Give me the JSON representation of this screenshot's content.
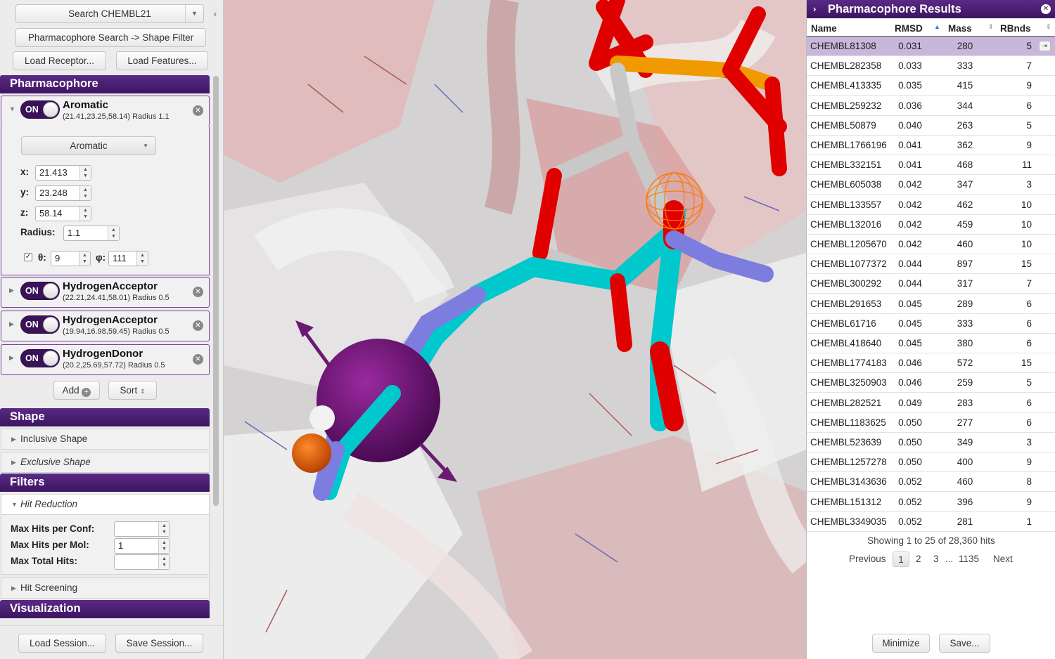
{
  "left": {
    "search_label": "Search CHEMBL21",
    "search_filter_label": "Pharmacophore Search -> Shape Filter",
    "load_receptor": "Load Receptor...",
    "load_features": "Load Features...",
    "pharmacophore_header": "Pharmacophore",
    "features": [
      {
        "toggle": "ON",
        "name": "Aromatic",
        "info": "(21.41,23.25,58.14) Radius 1.1"
      },
      {
        "toggle": "ON",
        "name": "HydrogenAcceptor",
        "info": "(22.21,24.41,58.01) Radius 0.5"
      },
      {
        "toggle": "ON",
        "name": "HydrogenAcceptor",
        "info": "(19.94,16.98,59.45) Radius 0.5"
      },
      {
        "toggle": "ON",
        "name": "HydrogenDonor",
        "info": "(20.2,25.69,57.72) Radius 0.5"
      }
    ],
    "editor": {
      "type": "Aromatic",
      "x_label": "x:",
      "x": "21.413",
      "y_label": "y:",
      "y": "23.248",
      "z_label": "z:",
      "z": "58.14",
      "radius_label": "Radius:",
      "radius": "1.1",
      "theta_label": "θ:",
      "theta": "9",
      "phi_label": "φ:",
      "phi": "111"
    },
    "add_label": "Add",
    "sort_label": "Sort",
    "shape_header": "Shape",
    "inclusive_shape": "Inclusive Shape",
    "exclusive_shape": "Exclusive Shape",
    "filters_header": "Filters",
    "hit_reduction": "Hit Reduction",
    "max_hits_conf_label": "Max Hits per Conf:",
    "max_hits_conf": "",
    "max_hits_mol_label": "Max Hits per Mol:",
    "max_hits_mol": "1",
    "max_total_label": "Max Total Hits:",
    "max_total": "",
    "hit_screening": "Hit Screening",
    "visualization_header": "Visualization",
    "load_session": "Load Session...",
    "save_session": "Save Session..."
  },
  "results": {
    "title": "Pharmacophore Results",
    "columns": [
      "Name",
      "RMSD",
      "Mass",
      "RBnds"
    ],
    "rows": [
      [
        "CHEMBL81308",
        "0.031",
        "280",
        "5"
      ],
      [
        "CHEMBL282358",
        "0.033",
        "333",
        "7"
      ],
      [
        "CHEMBL413335",
        "0.035",
        "415",
        "9"
      ],
      [
        "CHEMBL259232",
        "0.036",
        "344",
        "6"
      ],
      [
        "CHEMBL50879",
        "0.040",
        "263",
        "5"
      ],
      [
        "CHEMBL1766196",
        "0.041",
        "362",
        "9"
      ],
      [
        "CHEMBL332151",
        "0.041",
        "468",
        "11"
      ],
      [
        "CHEMBL605038",
        "0.042",
        "347",
        "3"
      ],
      [
        "CHEMBL133557",
        "0.042",
        "462",
        "10"
      ],
      [
        "CHEMBL132016",
        "0.042",
        "459",
        "10"
      ],
      [
        "CHEMBL1205670",
        "0.042",
        "460",
        "10"
      ],
      [
        "CHEMBL1077372",
        "0.044",
        "897",
        "15"
      ],
      [
        "CHEMBL300292",
        "0.044",
        "317",
        "7"
      ],
      [
        "CHEMBL291653",
        "0.045",
        "289",
        "6"
      ],
      [
        "CHEMBL61716",
        "0.045",
        "333",
        "6"
      ],
      [
        "CHEMBL418640",
        "0.045",
        "380",
        "6"
      ],
      [
        "CHEMBL1774183",
        "0.046",
        "572",
        "15"
      ],
      [
        "CHEMBL3250903",
        "0.046",
        "259",
        "5"
      ],
      [
        "CHEMBL282521",
        "0.049",
        "283",
        "6"
      ],
      [
        "CHEMBL1183625",
        "0.050",
        "277",
        "6"
      ],
      [
        "CHEMBL523639",
        "0.050",
        "349",
        "3"
      ],
      [
        "CHEMBL1257278",
        "0.050",
        "400",
        "9"
      ],
      [
        "CHEMBL3143636",
        "0.052",
        "460",
        "8"
      ],
      [
        "CHEMBL151312",
        "0.052",
        "396",
        "9"
      ],
      [
        "CHEMBL3349035",
        "0.052",
        "281",
        "1"
      ]
    ],
    "showing": "Showing 1 to 25 of 28,360 hits",
    "previous": "Previous",
    "pages": [
      "1",
      "2",
      "3",
      "...",
      "1135"
    ],
    "next": "Next",
    "minimize": "Minimize",
    "save": "Save..."
  },
  "colors": {
    "header_purple": "#4a1c70",
    "selected_row": "#c9b6db"
  }
}
